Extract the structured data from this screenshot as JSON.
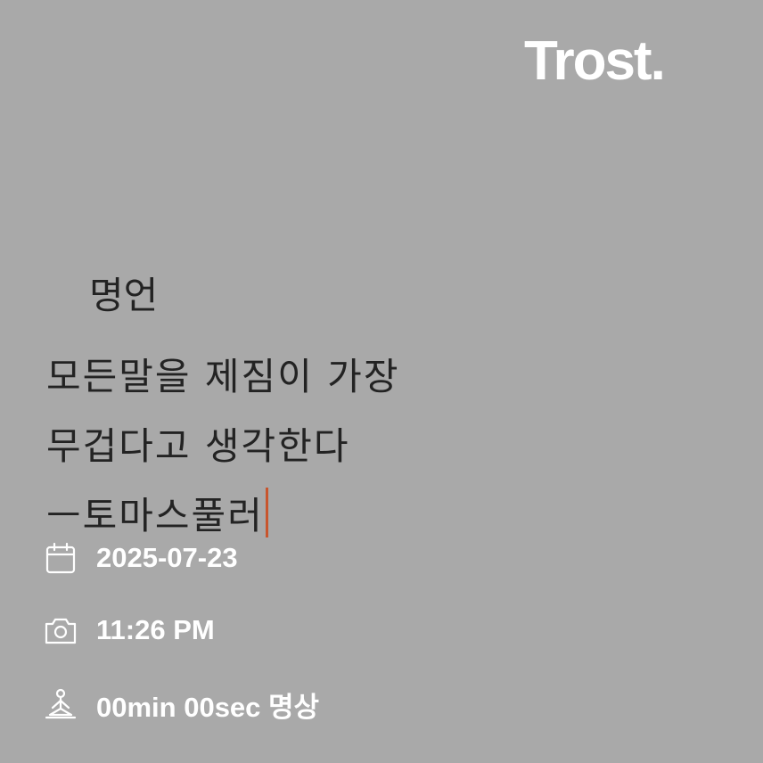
{
  "brand": {
    "logo_text": "Trost."
  },
  "note": {
    "title": "명언",
    "lines": [
      "모든말을 제짐이 가장",
      "무겁다고 생각한다",
      "ㅡ토마스풀러"
    ],
    "cursor_color": "#c8552d"
  },
  "meta": {
    "date": {
      "icon": "calendar-icon",
      "value": "2025-07-23"
    },
    "time": {
      "icon": "camera-icon",
      "value": "11:26 PM"
    },
    "meditation": {
      "icon": "meditation-icon",
      "value": "00min 00sec 명상"
    }
  },
  "colors": {
    "background": "#a9a9a9",
    "text_dark": "#232323",
    "text_light": "#ffffff"
  }
}
